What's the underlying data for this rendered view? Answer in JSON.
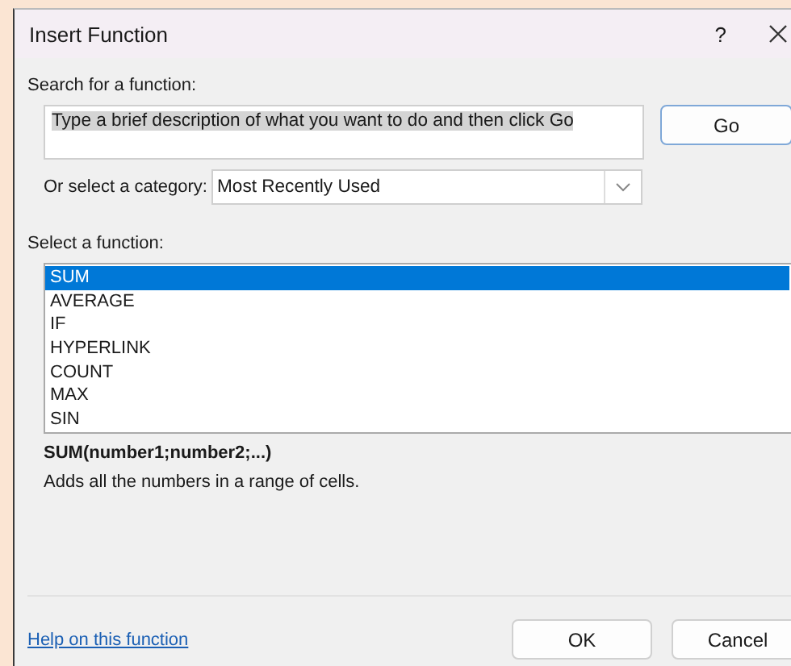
{
  "window": {
    "title": "Insert Function",
    "help_button": "?"
  },
  "search": {
    "label": "Search for a function:",
    "value": "Type a brief description of what you want to do and then click Go",
    "text_selected": true
  },
  "go_button": "Go",
  "category": {
    "label": "Or select a category:",
    "value": "Most Recently Used"
  },
  "functions": {
    "label": "Select a function:",
    "items": [
      {
        "name": "SUM",
        "selected": true
      },
      {
        "name": "AVERAGE",
        "selected": false
      },
      {
        "name": "IF",
        "selected": false
      },
      {
        "name": "HYPERLINK",
        "selected": false
      },
      {
        "name": "COUNT",
        "selected": false
      },
      {
        "name": "MAX",
        "selected": false
      },
      {
        "name": "SIN",
        "selected": false
      }
    ]
  },
  "signature": "SUM(number1;number2;...)",
  "description": "Adds all the numbers in a range of cells.",
  "help_link": "Help on this function",
  "buttons": [
    "OK",
    "Cancel"
  ]
}
